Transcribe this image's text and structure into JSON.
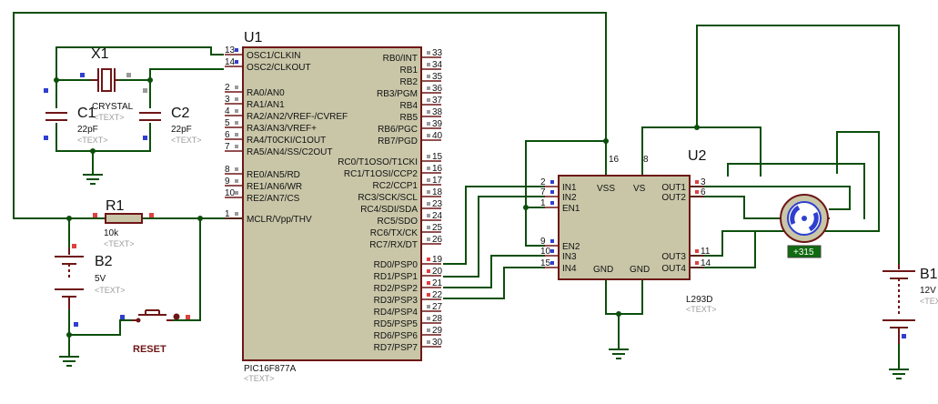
{
  "u1": {
    "ref": "U1",
    "part": "PIC16F877A",
    "text_placeholder": "<TEXT>",
    "left_pins": [
      {
        "num": "13",
        "label": "OSC1/CLKIN"
      },
      {
        "num": "14",
        "label": "OSC2/CLKOUT"
      },
      {
        "num": "2",
        "label": "RA0/AN0"
      },
      {
        "num": "3",
        "label": "RA1/AN1"
      },
      {
        "num": "4",
        "label": "RA2/AN2/VREF-/CVREF"
      },
      {
        "num": "5",
        "label": "RA3/AN3/VREF+"
      },
      {
        "num": "6",
        "label": "RA4/T0CKI/C1OUT"
      },
      {
        "num": "7",
        "label": "RA5/AN4/SS/C2OUT"
      },
      {
        "num": "8",
        "label": "RE0/AN5/RD"
      },
      {
        "num": "9",
        "label": "RE1/AN6/WR"
      },
      {
        "num": "10",
        "label": "RE2/AN7/CS"
      },
      {
        "num": "1",
        "label": "MCLR/Vpp/THV"
      }
    ],
    "right_pins": [
      {
        "num": "33",
        "label": "RB0/INT"
      },
      {
        "num": "34",
        "label": "RB1"
      },
      {
        "num": "35",
        "label": "RB2"
      },
      {
        "num": "36",
        "label": "RB3/PGM"
      },
      {
        "num": "37",
        "label": "RB4"
      },
      {
        "num": "38",
        "label": "RB5"
      },
      {
        "num": "39",
        "label": "RB6/PGC"
      },
      {
        "num": "40",
        "label": "RB7/PGD"
      },
      {
        "num": "15",
        "label": "RC0/T1OSO/T1CKI"
      },
      {
        "num": "16",
        "label": "RC1/T1OSI/CCP2"
      },
      {
        "num": "17",
        "label": "RC2/CCP1"
      },
      {
        "num": "18",
        "label": "RC3/SCK/SCL"
      },
      {
        "num": "23",
        "label": "RC4/SDI/SDA"
      },
      {
        "num": "24",
        "label": "RC5/SDO"
      },
      {
        "num": "25",
        "label": "RC6/TX/CK"
      },
      {
        "num": "26",
        "label": "RC7/RX/DT"
      },
      {
        "num": "19",
        "label": "RD0/PSP0"
      },
      {
        "num": "20",
        "label": "RD1/PSP1"
      },
      {
        "num": "21",
        "label": "RD2/PSP2"
      },
      {
        "num": "22",
        "label": "RD3/PSP3"
      },
      {
        "num": "27",
        "label": "RD4/PSP4"
      },
      {
        "num": "28",
        "label": "RD5/PSP5"
      },
      {
        "num": "29",
        "label": "RD6/PSP6"
      },
      {
        "num": "30",
        "label": "RD7/PSP7"
      }
    ]
  },
  "u2": {
    "ref": "U2",
    "part": "L293D",
    "text_placeholder": "<TEXT>",
    "left_pins": [
      {
        "num": "2",
        "label": "IN1"
      },
      {
        "num": "7",
        "label": "IN2"
      },
      {
        "num": "1",
        "label": "EN1"
      },
      {
        "num": "9",
        "label": "EN2"
      },
      {
        "num": "10",
        "label": "IN3"
      },
      {
        "num": "15",
        "label": "IN4"
      }
    ],
    "right_pins": [
      {
        "num": "3",
        "label": "OUT1"
      },
      {
        "num": "6",
        "label": "OUT2"
      },
      {
        "num": "11",
        "label": "OUT3"
      },
      {
        "num": "14",
        "label": "OUT4"
      }
    ],
    "top_pins": [
      {
        "num": "16",
        "label": "VSS"
      },
      {
        "num": "8",
        "label": "VS"
      }
    ],
    "bottom_labels": [
      "GND",
      "GND"
    ]
  },
  "x1": {
    "ref": "X1",
    "value": "CRYSTAL",
    "text_placeholder": "<TEXT>"
  },
  "c1": {
    "ref": "C1",
    "value": "22pF",
    "text_placeholder": "<TEXT>"
  },
  "c2": {
    "ref": "C2",
    "value": "22pF",
    "text_placeholder": "<TEXT>"
  },
  "r1": {
    "ref": "R1",
    "value": "10k",
    "text_placeholder": "<TEXT>"
  },
  "b2": {
    "ref": "B2",
    "value": "5V",
    "text_placeholder": "<TEXT>"
  },
  "b1": {
    "ref": "B1",
    "value": "12V",
    "text_placeholder": "<TEXT>"
  },
  "reset": {
    "label": "RESET"
  },
  "motor": {
    "readout": "+315"
  },
  "colors": {
    "wire": "#0b4f0b",
    "component_outline": "#6e1616",
    "ic_fill": "#c9c6a8",
    "pin_red": "#e04040",
    "pin_blue": "#2f3fcf",
    "placeholder_gray": "#9c9c9c",
    "motor_badge": "#0f6b0f"
  }
}
